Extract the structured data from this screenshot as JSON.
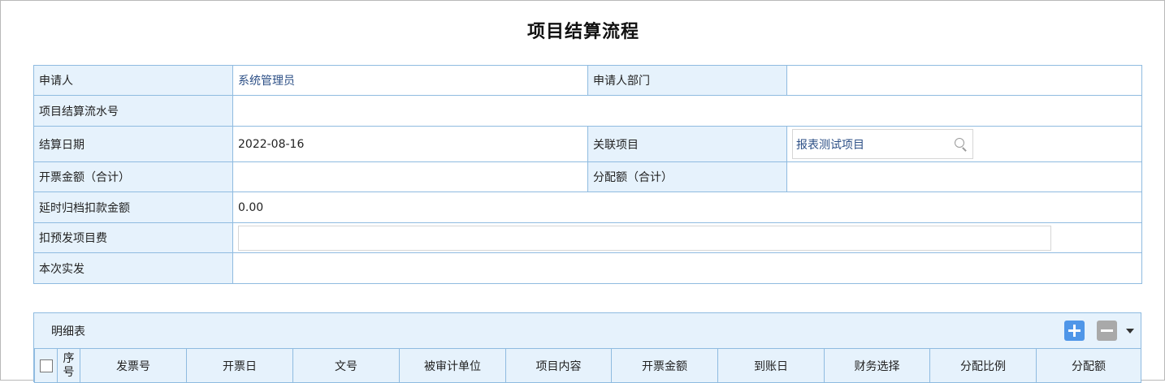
{
  "title": "项目结算流程",
  "form": {
    "applicant_label": "申请人",
    "applicant_value": "系统管理员",
    "department_label": "申请人部门",
    "department_value": "",
    "serial_label": "项目结算流水号",
    "serial_value": "",
    "settle_date_label": "结算日期",
    "settle_date_value": "2022-08-16",
    "related_project_label": "关联项目",
    "related_project_value": "报表测试项目",
    "invoice_total_label": "开票金额（合计）",
    "invoice_total_value": "",
    "allocation_total_label": "分配额（合计）",
    "allocation_total_value": "",
    "delay_deduction_label": "延时归档扣款金额",
    "delay_deduction_value": "0.00",
    "prepaid_fee_label": "扣预发项目费",
    "prepaid_fee_value": "",
    "actual_payment_label": "本次实发",
    "actual_payment_value": ""
  },
  "detail": {
    "title": "明细表",
    "icons": {
      "add": "plus-icon",
      "remove": "minus-icon",
      "menu": "caret-down-icon"
    },
    "columns": {
      "seq_top": "序",
      "seq_bottom": "号",
      "invoice_no": "发票号",
      "invoice_date": "开票日",
      "doc_no": "文号",
      "audited_unit": "被审计单位",
      "project_content": "项目内容",
      "invoice_amount": "开票金额",
      "arrival_date": "到账日",
      "finance_choice": "财务选择",
      "allocation_ratio": "分配比例",
      "allocation_amount": "分配额"
    }
  },
  "colors": {
    "label_bg": "#e6f2fc",
    "border": "#8fbbe0",
    "link_text": "#2c4f86",
    "add_button": "#4f96e8",
    "remove_button": "#a9a9a9"
  }
}
